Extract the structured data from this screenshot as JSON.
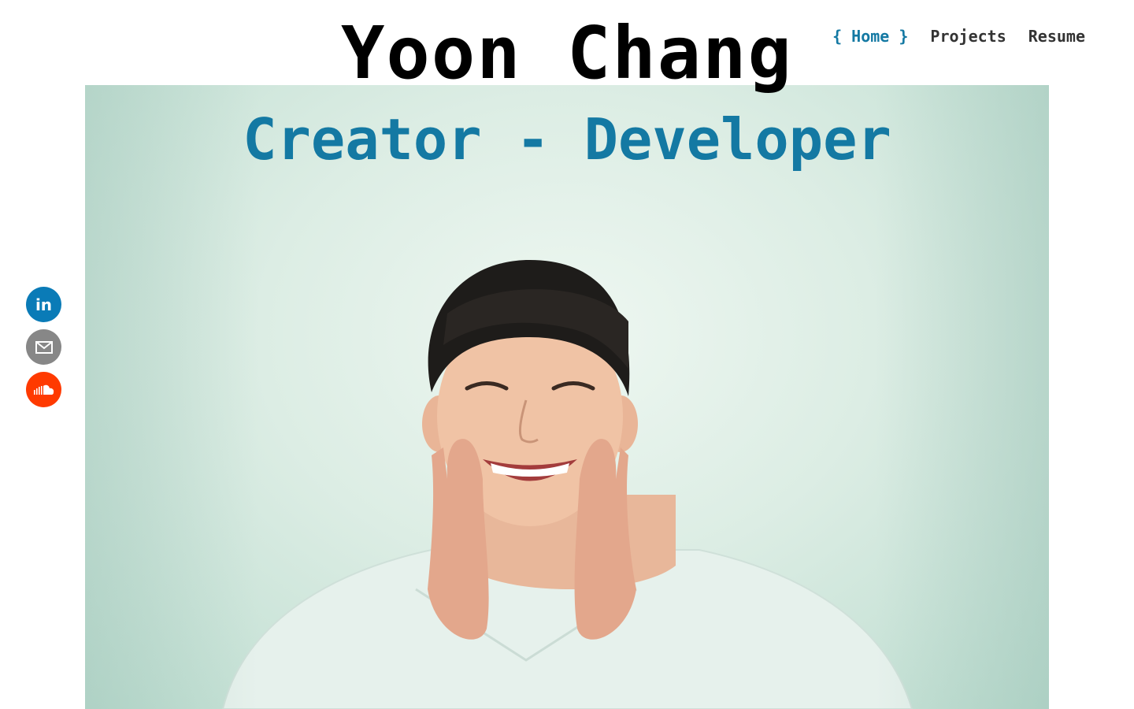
{
  "header": {
    "title": "Yoon Chang"
  },
  "nav": {
    "items": [
      {
        "label": "{ Home }",
        "active": true
      },
      {
        "label": "Projects",
        "active": false
      },
      {
        "label": "Resume",
        "active": false
      }
    ]
  },
  "hero": {
    "subtitle": "Creator - Developer",
    "image": "portrait-photo"
  },
  "social": {
    "items": [
      {
        "name": "LinkedIn",
        "icon": "linkedin-icon",
        "glyph": "in",
        "color": "#0a7bb7"
      },
      {
        "name": "Email",
        "icon": "email-icon",
        "color": "#878787"
      },
      {
        "name": "SoundCloud",
        "icon": "soundcloud-icon",
        "color": "#ff3a00"
      }
    ]
  },
  "colors": {
    "accent": "#1479a3",
    "title": "#000000",
    "nav_text": "#333333"
  }
}
